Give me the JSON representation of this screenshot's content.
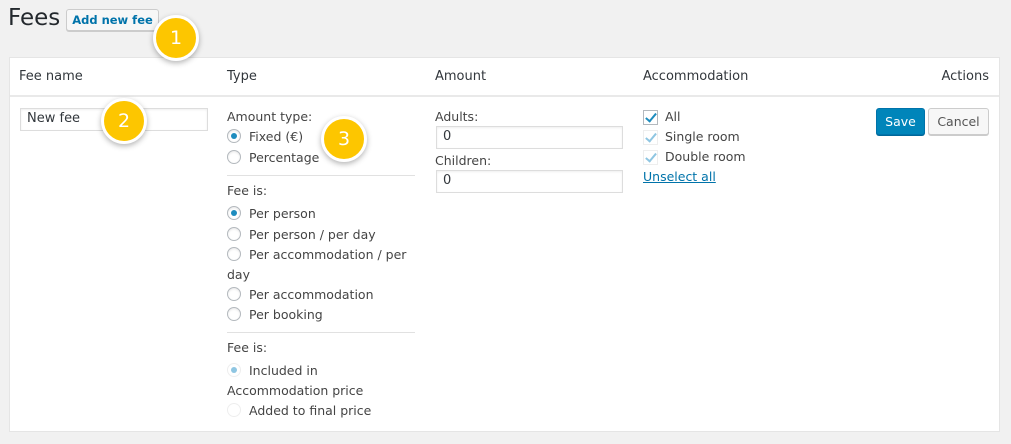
{
  "page": {
    "title": "Fees",
    "add_button": "Add new fee"
  },
  "table": {
    "headers": {
      "fee_name": "Fee name",
      "type": "Type",
      "amount": "Amount",
      "accommodation": "Accommodation",
      "actions": "Actions"
    },
    "row": {
      "fee_name_value": "New fee",
      "amount_type_label": "Amount type:",
      "amount_type_options": [
        {
          "label": "Fixed (€)",
          "checked": true
        },
        {
          "label": "Percentage",
          "checked": false
        }
      ],
      "fee_is_label": "Fee is:",
      "fee_is_options": [
        {
          "label": "Per person",
          "checked": true
        },
        {
          "label": "Per person / per day",
          "checked": false
        },
        {
          "label": "Per accommodation / per day",
          "checked": false
        },
        {
          "label": "Per accommodation",
          "checked": false
        },
        {
          "label": "Per booking",
          "checked": false
        }
      ],
      "fee_is2_label": "Fee is:",
      "fee_is2_options": [
        {
          "label": "Included in Accommodation price",
          "checked": true,
          "disabled": true
        },
        {
          "label": "Added to final price",
          "checked": false,
          "disabled": true
        }
      ],
      "adults_label": "Adults:",
      "adults_value": "0",
      "children_label": "Children:",
      "children_value": "0",
      "accommodations": [
        {
          "label": "All",
          "checked": true
        },
        {
          "label": "Single room",
          "checked": true,
          "disabled": true
        },
        {
          "label": "Double room",
          "checked": true,
          "disabled": true
        }
      ],
      "unselect_all": "Unselect all",
      "save": "Save",
      "cancel": "Cancel"
    }
  },
  "badges": [
    "1",
    "2",
    "3"
  ],
  "colors": {
    "accent": "#0085ba",
    "badge": "#fdc600",
    "link": "#0073aa"
  }
}
